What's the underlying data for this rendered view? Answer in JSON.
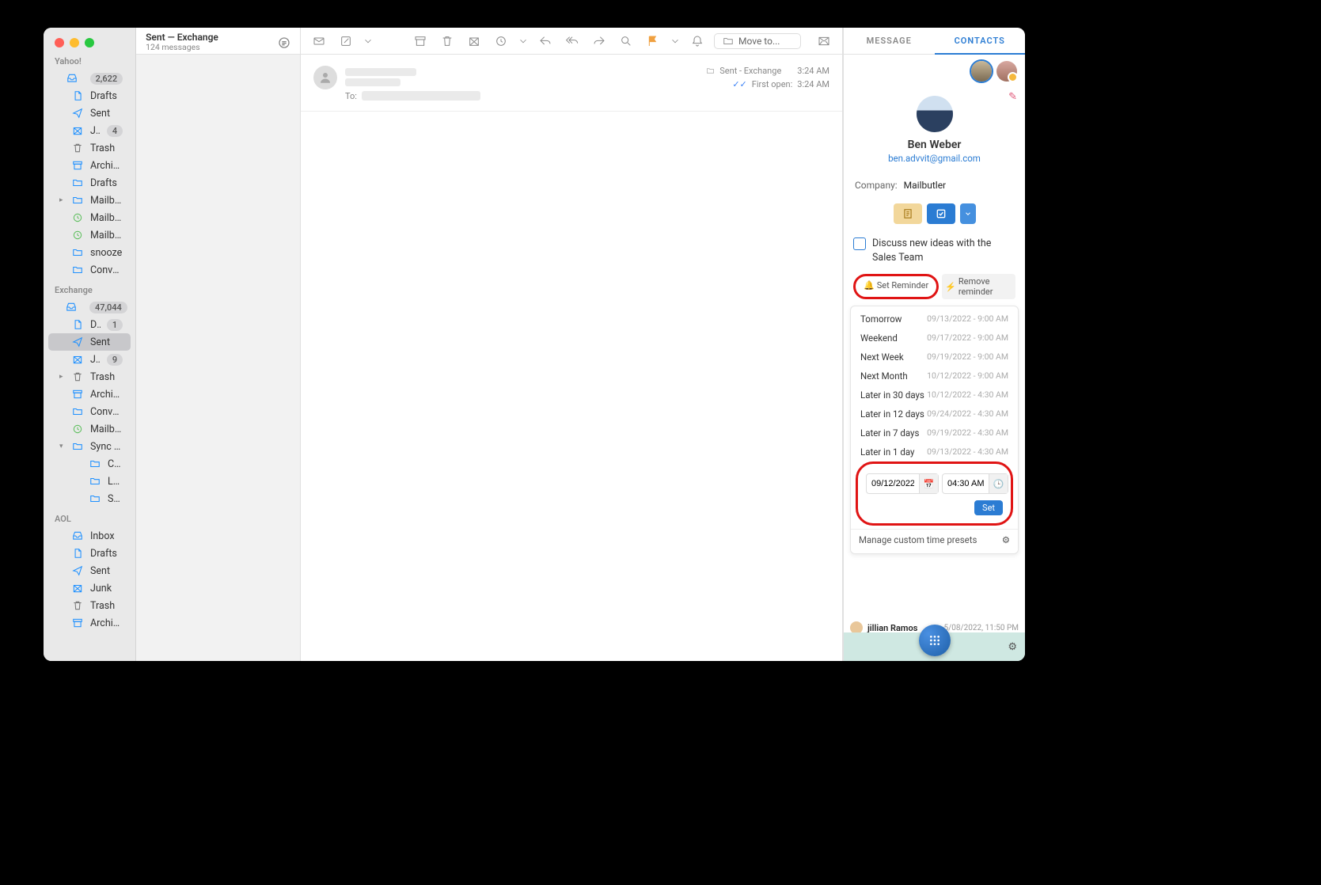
{
  "list_header": {
    "title": "Sent — Exchange",
    "subtitle": "124 messages"
  },
  "accounts": [
    {
      "name": "Yahoo!",
      "folders": [
        {
          "icon": "inbox",
          "label": "Inbox",
          "count": "2,622",
          "indent": 0
        },
        {
          "icon": "draft",
          "label": "Drafts",
          "indent": 0
        },
        {
          "icon": "sent",
          "label": "Sent",
          "indent": 0
        },
        {
          "icon": "junk",
          "label": "Junk",
          "count": "4",
          "indent": 0
        },
        {
          "icon": "trash",
          "label": "Trash",
          "indent": 0
        },
        {
          "icon": "archive",
          "label": "Archive",
          "indent": 0
        },
        {
          "icon": "folder",
          "label": "Drafts",
          "indent": 0
        },
        {
          "icon": "folder",
          "label": "Mailbutler",
          "indent": 0,
          "disclosure": ">"
        },
        {
          "icon": "clock-green",
          "label": "Mailbutler - Scheduled",
          "indent": 0
        },
        {
          "icon": "clock-green",
          "label": "Mailbutler - Snoozed",
          "indent": 0
        },
        {
          "icon": "folder",
          "label": "snooze",
          "indent": 0
        },
        {
          "icon": "folder",
          "label": "Conversation History",
          "indent": 0
        }
      ]
    },
    {
      "name": "Exchange",
      "folders": [
        {
          "icon": "inbox",
          "label": "Inbox",
          "count": "47,044",
          "indent": 0
        },
        {
          "icon": "draft",
          "label": "Drafts",
          "count": "1",
          "indent": 0
        },
        {
          "icon": "sent",
          "label": "Sent",
          "indent": 0,
          "selected": true
        },
        {
          "icon": "junk",
          "label": "Junk",
          "count": "9",
          "indent": 0
        },
        {
          "icon": "trash",
          "label": "Trash",
          "indent": 0,
          "disclosure": ">"
        },
        {
          "icon": "archive",
          "label": "Archive",
          "indent": 0
        },
        {
          "icon": "folder",
          "label": "Conversation History",
          "indent": 0
        },
        {
          "icon": "clock-green",
          "label": "Mailbutler - Scheduled",
          "indent": 0
        },
        {
          "icon": "folder",
          "label": "Sync Issues",
          "indent": 0,
          "disclosure": "v"
        },
        {
          "icon": "folder",
          "label": "Conflicts",
          "indent": 1
        },
        {
          "icon": "folder",
          "label": "Local Failures",
          "indent": 1
        },
        {
          "icon": "folder",
          "label": "Server Failures",
          "indent": 1
        }
      ]
    },
    {
      "name": "AOL",
      "folders": [
        {
          "icon": "inbox",
          "label": "Inbox",
          "indent": 0
        },
        {
          "icon": "draft",
          "label": "Drafts",
          "indent": 0
        },
        {
          "icon": "sent",
          "label": "Sent",
          "indent": 0
        },
        {
          "icon": "junk",
          "label": "Junk",
          "indent": 0
        },
        {
          "icon": "trash",
          "label": "Trash",
          "indent": 0
        },
        {
          "icon": "archive",
          "label": "Archive",
          "indent": 0
        }
      ]
    }
  ],
  "toolbar": {
    "move_label": "Move to..."
  },
  "message": {
    "folder": "Sent - Exchange",
    "time": "3:24 AM",
    "first_open_label": "First open:",
    "first_open_time": "3:24 AM",
    "to_label": "To:"
  },
  "panel_tabs": {
    "message": "MESSAGE",
    "contacts": "CONTACTS"
  },
  "contact": {
    "name": "Ben Weber",
    "email": "ben.advvit@gmail.com",
    "company_label": "Company:",
    "company": "Mailbutler"
  },
  "task": {
    "text": "Discuss new ideas with the Sales Team",
    "set_reminder": "Set Reminder",
    "remove_reminder": "Remove reminder"
  },
  "presets": [
    {
      "label": "Tomorrow",
      "date": "09/13/2022 - 9:00 AM"
    },
    {
      "label": "Weekend",
      "date": "09/17/2022 - 9:00 AM"
    },
    {
      "label": "Next Week",
      "date": "09/19/2022 - 9:00 AM"
    },
    {
      "label": "Next Month",
      "date": "10/12/2022 - 9:00 AM"
    },
    {
      "label": "Later in 30 days",
      "date": "10/12/2022 - 4:30 AM"
    },
    {
      "label": "Later in 12 days",
      "date": "09/24/2022 - 4:30 AM"
    },
    {
      "label": "Later in 7 days",
      "date": "09/19/2022 - 4:30 AM"
    },
    {
      "label": "Later in 1 day",
      "date": "09/13/2022 - 4:30 AM"
    }
  ],
  "custom": {
    "date": "09/12/2022",
    "time": "04:30 AM",
    "set": "Set"
  },
  "manage_presets": "Manage custom time presets",
  "recent": {
    "name": "jillian Ramos",
    "time": "5/08/2022, 11:50 PM"
  }
}
